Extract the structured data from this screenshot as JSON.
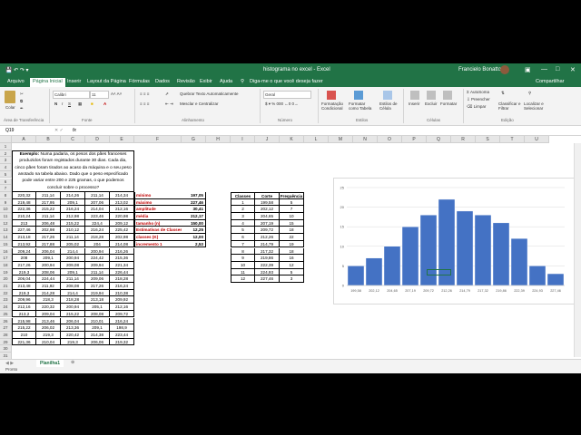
{
  "window": {
    "title": "histograma no excel  -  Excel",
    "tell_me": "Diga-me o que você deseja fazer",
    "user": "Francielo Bonatto",
    "share": "Compartilhar"
  },
  "tabs": [
    "Arquivo",
    "Página Inicial",
    "Inserir",
    "Layout da Página",
    "Fórmulas",
    "Dados",
    "Revisão",
    "Exibir",
    "Ajuda"
  ],
  "ribbon": {
    "paste": "Colar",
    "clipboard": "Área de Transferência",
    "font_name": "Calibri",
    "font_size": "11",
    "font_group": "Fonte",
    "wrap_text": "Quebrar Texto Automaticamente",
    "merge_center": "Mesclar e Centralizar",
    "alignment_group": "Alinhamento",
    "number_format": "Geral",
    "number_group": "Número",
    "conditional": "Formatação Condicional",
    "format_table": "Formatar como Tabela",
    "cell_styles": "Estilos de Célula",
    "styles_group": "Estilos",
    "insert": "Inserir",
    "delete": "Excluir",
    "format": "Formatar",
    "cells_group": "Células",
    "autosum": "AutoSoma",
    "fill": "Preencher",
    "clear": "Limpar",
    "sort_filter": "Classificar e Filtrar",
    "find_select": "Localizar e Selecionar",
    "editing_group": "Edição"
  },
  "formula_bar": {
    "name_box": "Q19",
    "fx": "fx",
    "formula": ""
  },
  "columns": [
    "A",
    "B",
    "C",
    "D",
    "E",
    "F",
    "G",
    "H",
    "I",
    "J",
    "K",
    "L",
    "M",
    "N",
    "O",
    "P",
    "Q",
    "R",
    "S",
    "T",
    "U"
  ],
  "rows": [
    1,
    2,
    3,
    4,
    5,
    6,
    7,
    8,
    9,
    10,
    11,
    12,
    13,
    14,
    15,
    16,
    17,
    18,
    19,
    20,
    21,
    22,
    23,
    24,
    25,
    26,
    27,
    28,
    29,
    30,
    31
  ],
  "example_text": "Exemplo: Numa padaria, os pesos dos pães franceses produzidos foram registados durante 30 dias. Cada dia, cinco pães foram tirados ao acaso da máquina e o seu peso anotado na tabela abaixo. Dado que o peso especificado pode variar entre 200 e 225 gramas, o que podemos concluir sobre o processo?",
  "data_rows": [
    [
      "220,32",
      "211,14",
      "214,26",
      "211,14",
      "214,34"
    ],
    [
      "219,48",
      "217,95",
      "209,1",
      "207,06",
      "213,02"
    ],
    [
      "222,36",
      "215,22",
      "216,24",
      "214,04",
      "212,16"
    ],
    [
      "210,24",
      "211,14",
      "212,98",
      "223,46",
      "220,98"
    ],
    [
      "213",
      "206,48",
      "215,22",
      "224,4",
      "209,12"
    ],
    [
      "227,46",
      "202,98",
      "210,12",
      "216,24",
      "225,42"
    ],
    [
      "213,18",
      "217,26",
      "211,14",
      "218,28",
      "202,98"
    ],
    [
      "213,92",
      "217,88",
      "205,02",
      "204",
      "214,08"
    ],
    [
      "209,24",
      "206,04",
      "214,4",
      "200,94",
      "216,26"
    ],
    [
      "208",
      "209,1",
      "200,94",
      "224,42",
      "215,36"
    ],
    [
      "217,26",
      "200,94",
      "209,08",
      "209,94",
      "221,34"
    ],
    [
      "219,3",
      "208,06",
      "209,1",
      "211,14",
      "226,44"
    ],
    [
      "206,04",
      "224,44",
      "211,14",
      "209,06",
      "218,28"
    ],
    [
      "213,48",
      "211,92",
      "208,08",
      "217,26",
      "216,24"
    ],
    [
      "219,3",
      "214,28",
      "214,4",
      "219,94",
      "210,38"
    ],
    [
      "209,96",
      "218,3",
      "218,28",
      "213,18",
      "209,92"
    ],
    [
      "212,16",
      "220,32",
      "200,94",
      "205,1",
      "212,16"
    ],
    [
      "213,2",
      "209,04",
      "215,22",
      "208,08",
      "209,72"
    ],
    [
      "215,98",
      "213,46",
      "206,04",
      "210,01",
      "216,24"
    ],
    [
      "215,22",
      "206,02",
      "213,36",
      "209,1",
      "198,9"
    ],
    [
      "210",
      "219,3",
      "220,42",
      "214,38",
      "223,44"
    ],
    [
      "221,36",
      "210,04",
      "219,3",
      "206,06",
      "219,32"
    ]
  ],
  "stats": [
    {
      "label": "mínimo",
      "value": "197,05"
    },
    {
      "label": "máximo",
      "value": "227,46"
    },
    {
      "label": "amplitude",
      "value": "30,41"
    },
    {
      "label": "média",
      "value": "212,17"
    },
    {
      "label": "tamanho (n)",
      "value": "150,00"
    },
    {
      "label": "Estimativas de Classes (K)",
      "value": "12,25"
    },
    {
      "label": "classes (K)",
      "value": "12,00"
    },
    {
      "label": "incremento 1",
      "value": "2,53"
    }
  ],
  "freq_table": {
    "headers": [
      "Classes",
      "Corte",
      "Frequência"
    ],
    "rows": [
      [
        "1",
        "199,58",
        "5"
      ],
      [
        "2",
        "202,12",
        "7"
      ],
      [
        "3",
        "204,65",
        "10"
      ],
      [
        "4",
        "207,19",
        "15"
      ],
      [
        "5",
        "209,72",
        "18"
      ],
      [
        "6",
        "212,26",
        "22"
      ],
      [
        "7",
        "214,79",
        "19"
      ],
      [
        "8",
        "217,32",
        "18"
      ],
      [
        "9",
        "219,86",
        "16"
      ],
      [
        "10",
        "222,39",
        "12"
      ],
      [
        "11",
        "224,93",
        "5"
      ],
      [
        "12",
        "227,46",
        "3"
      ]
    ]
  },
  "chart_data": {
    "type": "bar",
    "categories": [
      "199,58",
      "202,12",
      "204,65",
      "207,19",
      "209,72",
      "212,26",
      "214,79",
      "217,32",
      "219,86",
      "222,39",
      "224,93",
      "227,46"
    ],
    "values": [
      5,
      7,
      10,
      15,
      18,
      22,
      19,
      18,
      16,
      12,
      5,
      3
    ],
    "ylim": [
      0,
      25
    ],
    "yticks": [
      "0",
      "5",
      "10",
      "15",
      "20",
      "25"
    ],
    "bar_color": "#4472c4",
    "grid": true
  },
  "sheet": {
    "tab": "Planilha1",
    "status": "Pronto"
  },
  "colors": {
    "excel_green": "#217346",
    "label_red": "#c00000"
  }
}
